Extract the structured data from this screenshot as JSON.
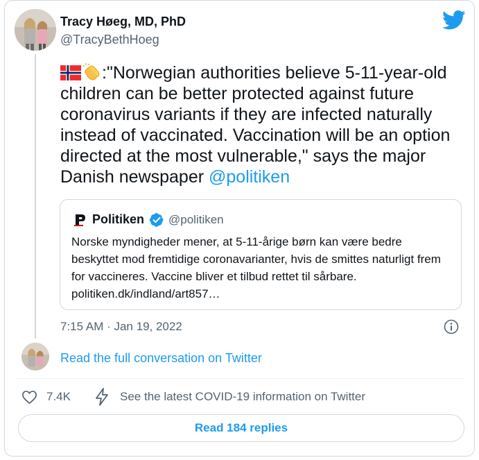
{
  "author": {
    "name": "Tracy Høeg, MD, PhD",
    "handle": "@TracyBethHoeg"
  },
  "tweet": {
    "emoji": [
      "norway-flag",
      "clapping-hands"
    ],
    "body": ":\"Norwegian authorities believe 5-11-year-old children can be better protected against future coronavirus variants if they are infected naturally instead of vaccinated. Vaccination will be an option directed at the most vulnerable,\" says the major Danish newspaper ",
    "mention": "@politiken",
    "timestamp": "7:15 AM · Jan 19, 2022"
  },
  "quoted_tweet": {
    "name": "Politiken",
    "verified": true,
    "handle": "@politiken",
    "body": "Norske myndigheder mener, at 5-11-årige børn kan være bedre beskyttet mod fremtidige coronavarianter, hvis de smittes naturligt frem for vaccineres. Vaccine bliver et tilbud rettet til sårbare. politiken.dk/indland/art857…"
  },
  "actions": {
    "read_conversation": "Read the full conversation on Twitter",
    "like_count": "7.4K",
    "covid_info": "See the latest COVID-19 information on Twitter",
    "read_replies": "Read 184 replies"
  },
  "colors": {
    "accent": "#1d9bf0",
    "text": "#0f1419",
    "secondary": "#536471",
    "border": "#cfd9de"
  },
  "icons": [
    "twitter-bird-icon",
    "verified-badge-icon",
    "info-icon",
    "heart-icon",
    "lightning-icon",
    "politiken-logo"
  ]
}
